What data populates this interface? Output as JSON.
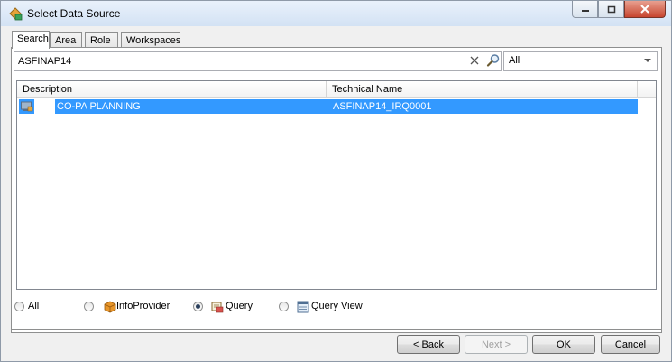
{
  "window": {
    "title": "Select Data Source"
  },
  "tabs": [
    {
      "label": "Search",
      "active": true
    },
    {
      "label": "Area",
      "active": false
    },
    {
      "label": "Role",
      "active": false
    },
    {
      "label": "Workspaces",
      "active": false
    }
  ],
  "search": {
    "value": "ASFINAP14",
    "scope_selected": "All"
  },
  "results": {
    "columns": [
      "Description",
      "Technical Name"
    ],
    "rows": [
      {
        "description": "CO-PA PLANNING",
        "technical_name": "ASFINAP14_IRQ0001",
        "selected": true
      }
    ]
  },
  "filter": {
    "options": [
      {
        "label": "All",
        "checked": false
      },
      {
        "label": "InfoProvider",
        "checked": false
      },
      {
        "label": "Query",
        "checked": true
      },
      {
        "label": "Query View",
        "checked": false
      }
    ]
  },
  "buttons": {
    "back": "< Back",
    "next": "Next >",
    "ok": "OK",
    "cancel": "Cancel"
  },
  "colors": {
    "selection": "#3399ff",
    "window_bg": "#f0f0f0"
  }
}
